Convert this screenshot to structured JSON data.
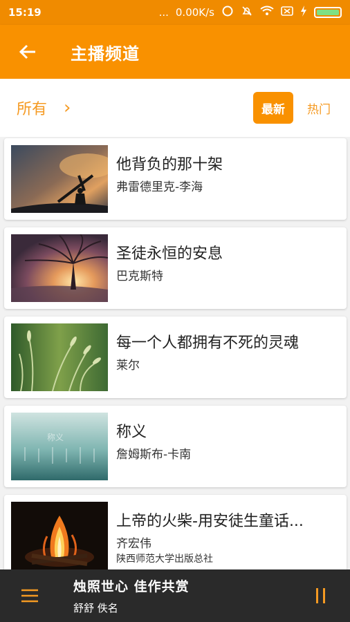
{
  "status_bar": {
    "time": "15:19",
    "dots": "...",
    "speed": "0.00K/s",
    "battery_level": 1.0
  },
  "app_bar": {
    "title": "主播频道",
    "back_icon": "arrow-left-icon"
  },
  "filter": {
    "category_label": "所有",
    "category_chevron": "›",
    "tabs": [
      {
        "label": "最新",
        "active": true
      },
      {
        "label": "热门",
        "active": false
      }
    ]
  },
  "items": [
    {
      "title": "他背负的那十架",
      "author": "弗雷德里克-李海",
      "thumb": "cross-silhouette-image"
    },
    {
      "title": "圣徒永恒的安息",
      "author": "巴克斯特",
      "thumb": "tree-sunset-image"
    },
    {
      "title": "每一个人都拥有不死的灵魂",
      "author": "莱尔",
      "thumb": "grass-field-image"
    },
    {
      "title": "称义",
      "author": "詹姆斯布-卡南",
      "thumb": "foggy-field-image",
      "thumb_caption": "称义"
    },
    {
      "title": "上帝的火柴-用安徒生童话...",
      "author": "齐宏伟",
      "publisher": "陕西师范大学出版总社",
      "thumb": "campfire-image"
    }
  ],
  "player": {
    "title": "烛照世心 佳作共赏",
    "author": "舒舒 佚名"
  },
  "colors": {
    "status_bar": "#f08b00",
    "app_bar": "#f99100",
    "accent_text": "#f59a22",
    "player_bg": "#2a2a2a"
  }
}
